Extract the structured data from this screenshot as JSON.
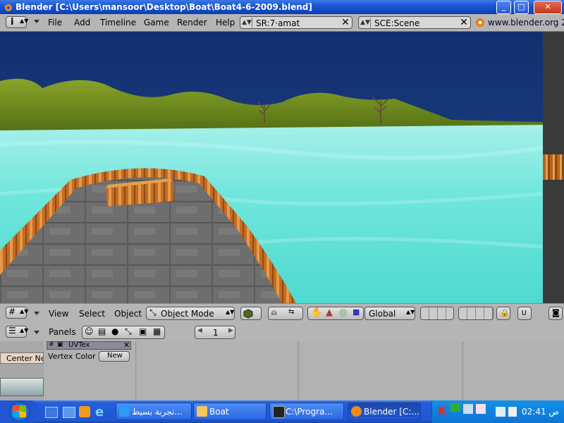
{
  "window": {
    "title": "Blender [C:\\Users\\mansoor\\Desktop\\Boat\\Boat4-6-2009.blend]",
    "controls": [
      "_",
      "□",
      "✕"
    ]
  },
  "header": {
    "menus": [
      "File",
      "Add",
      "Timeline",
      "Game",
      "Render",
      "Help"
    ],
    "screen_field": "SR:7·amat",
    "scene_field": "SCE:Scene",
    "website": "www.blender.org 2"
  },
  "viewport_header": {
    "menus": [
      "View",
      "Select",
      "Object"
    ],
    "mode": "Object Mode",
    "orientation": "Global"
  },
  "buttons_header": {
    "panels_label": "Panels",
    "frame": "1"
  },
  "panels": {
    "center_new": "Center Ne",
    "uvtex_label": "UVTex",
    "vertex_color_label": "Vertex Color",
    "new_button": "New"
  },
  "taskbar": {
    "tasks": [
      {
        "label": "تجربة بسيط...",
        "icon": "ie-icon"
      },
      {
        "label": "Boat",
        "icon": "folder-icon"
      },
      {
        "label": "C:\\Progra...",
        "icon": "console-icon"
      },
      {
        "label": "Blender [C:...",
        "icon": "blender-icon"
      }
    ],
    "clock": "02:41 ص"
  },
  "colors": {
    "sky": "#1a3a7a",
    "water": "#5fe0d8",
    "hills": "#6f8f1a",
    "boat_wood": "#c0692a",
    "deck": "#6f6f6f"
  }
}
